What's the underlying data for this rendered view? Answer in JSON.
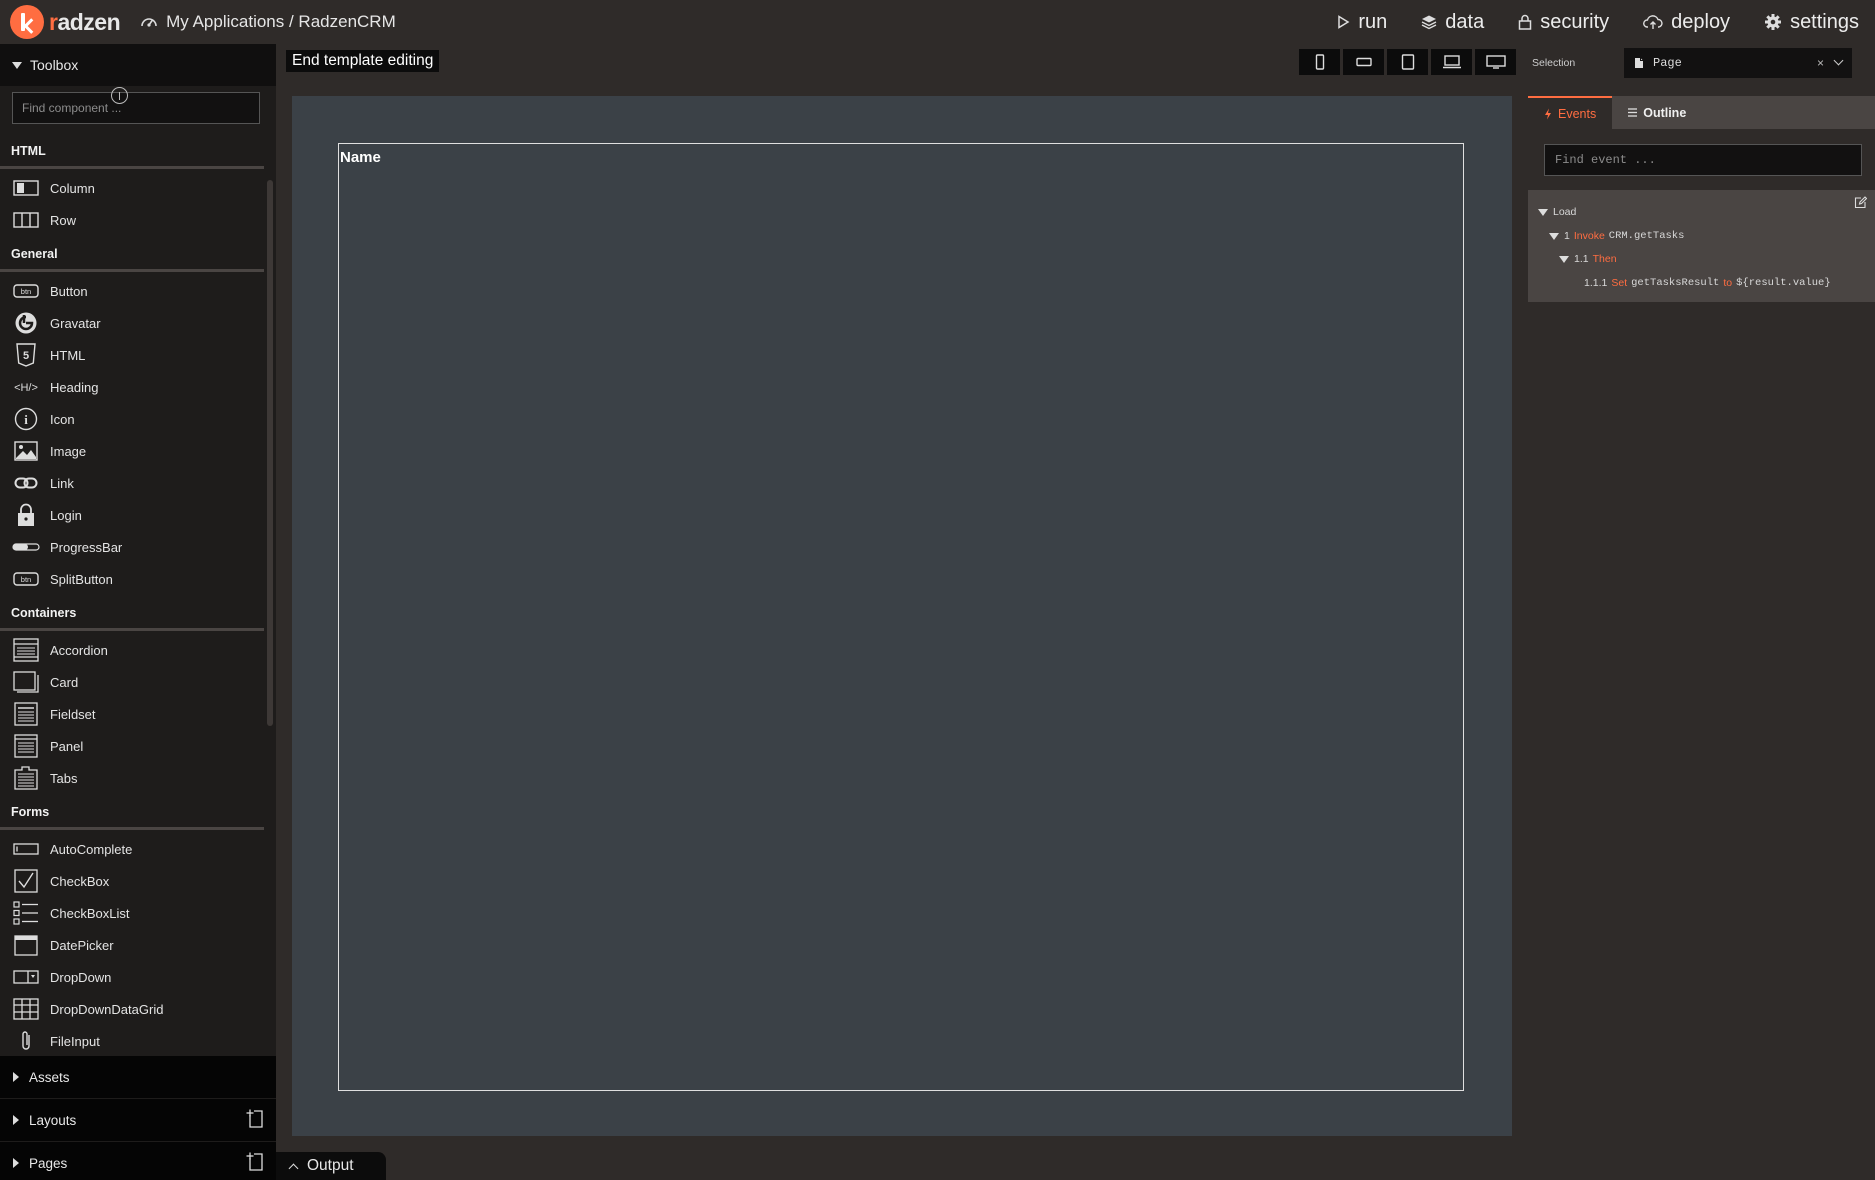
{
  "app": {
    "logo_text_prefix": "r",
    "logo_text_rest": "adzen",
    "breadcrumb": "My Applications / RadzenCRM"
  },
  "topnav": [
    {
      "label": "run",
      "icon": "play-icon"
    },
    {
      "label": "data",
      "icon": "layers-icon"
    },
    {
      "label": "security",
      "icon": "lock-icon"
    },
    {
      "label": "deploy",
      "icon": "cloud-upload-icon"
    },
    {
      "label": "settings",
      "icon": "gear-icon"
    }
  ],
  "toolbox": {
    "title": "Toolbox",
    "search_placeholder": "Find component ...",
    "categories": [
      {
        "name": "HTML",
        "items": [
          {
            "label": "Column",
            "icon": "column-icon"
          },
          {
            "label": "Row",
            "icon": "row-icon"
          }
        ]
      },
      {
        "name": "General",
        "items": [
          {
            "label": "Button",
            "icon": "button-icon"
          },
          {
            "label": "Gravatar",
            "icon": "gravatar-icon"
          },
          {
            "label": "HTML",
            "icon": "html5-icon"
          },
          {
            "label": "Heading",
            "icon": "heading-icon"
          },
          {
            "label": "Icon",
            "icon": "info-icon"
          },
          {
            "label": "Image",
            "icon": "image-icon"
          },
          {
            "label": "Link",
            "icon": "link-icon"
          },
          {
            "label": "Login",
            "icon": "lock-icon"
          },
          {
            "label": "ProgressBar",
            "icon": "progressbar-icon"
          },
          {
            "label": "SplitButton",
            "icon": "button-icon"
          }
        ]
      },
      {
        "name": "Containers",
        "items": [
          {
            "label": "Accordion",
            "icon": "accordion-icon"
          },
          {
            "label": "Card",
            "icon": "card-icon"
          },
          {
            "label": "Fieldset",
            "icon": "fieldset-icon"
          },
          {
            "label": "Panel",
            "icon": "panel-icon"
          },
          {
            "label": "Tabs",
            "icon": "tabs-icon"
          }
        ]
      },
      {
        "name": "Forms",
        "items": [
          {
            "label": "AutoComplete",
            "icon": "autocomplete-icon"
          },
          {
            "label": "CheckBox",
            "icon": "checkbox-icon"
          },
          {
            "label": "CheckBoxList",
            "icon": "checkboxlist-icon"
          },
          {
            "label": "DatePicker",
            "icon": "calendar-icon"
          },
          {
            "label": "DropDown",
            "icon": "dropdown-icon"
          },
          {
            "label": "DropDownDataGrid",
            "icon": "grid-icon"
          },
          {
            "label": "FileInput",
            "icon": "paperclip-icon"
          }
        ]
      }
    ]
  },
  "bottom_sections": [
    {
      "label": "Assets",
      "has_add": false
    },
    {
      "label": "Layouts",
      "has_add": true
    },
    {
      "label": "Pages",
      "has_add": true
    }
  ],
  "canvas": {
    "end_template_label": "End template editing",
    "template_label": "Name",
    "output_label": "Output"
  },
  "right_panel": {
    "selection_label": "Selection",
    "selection_value": "Page",
    "tabs": [
      {
        "label": "Events",
        "active": true
      },
      {
        "label": "Outline",
        "active": false
      }
    ],
    "event_search_placeholder": "Find event ...",
    "events": {
      "load": "Load",
      "step1_num": "1",
      "step1_kw": "Invoke",
      "step1_arg": "CRM.getTasks",
      "step11_num": "1.1",
      "step11_kw": "Then",
      "step111_num": "1.1.1",
      "step111_kw": "Set",
      "step111_target": "getTasksResult",
      "step111_to": "to",
      "step111_value": "${result.value}"
    }
  },
  "colors": {
    "accent": "#ff6d41",
    "topbar": "#2f2b29",
    "sidebar": "#1e1c1b",
    "canvas_surface": "#3b4147"
  }
}
